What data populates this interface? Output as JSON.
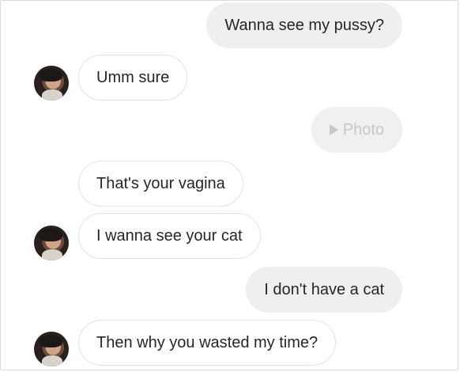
{
  "messages": [
    {
      "side": "out",
      "text": "Wanna see my pussy?"
    },
    {
      "side": "in",
      "text": "Umm sure"
    },
    {
      "side": "out",
      "type": "photo",
      "text": "Photo",
      "icon": "play-icon"
    },
    {
      "side": "in",
      "text": "That's your vagina"
    },
    {
      "side": "in",
      "text": "I wanna see your cat"
    },
    {
      "side": "out",
      "text": "I don't have a cat"
    },
    {
      "side": "in",
      "text": "Then why you wasted my time?"
    }
  ],
  "colors": {
    "outgoing_bubble": "#efefef",
    "incoming_bubble_border": "#e3e3e3",
    "text": "#262626",
    "photo_text": "#c7c7c7"
  }
}
